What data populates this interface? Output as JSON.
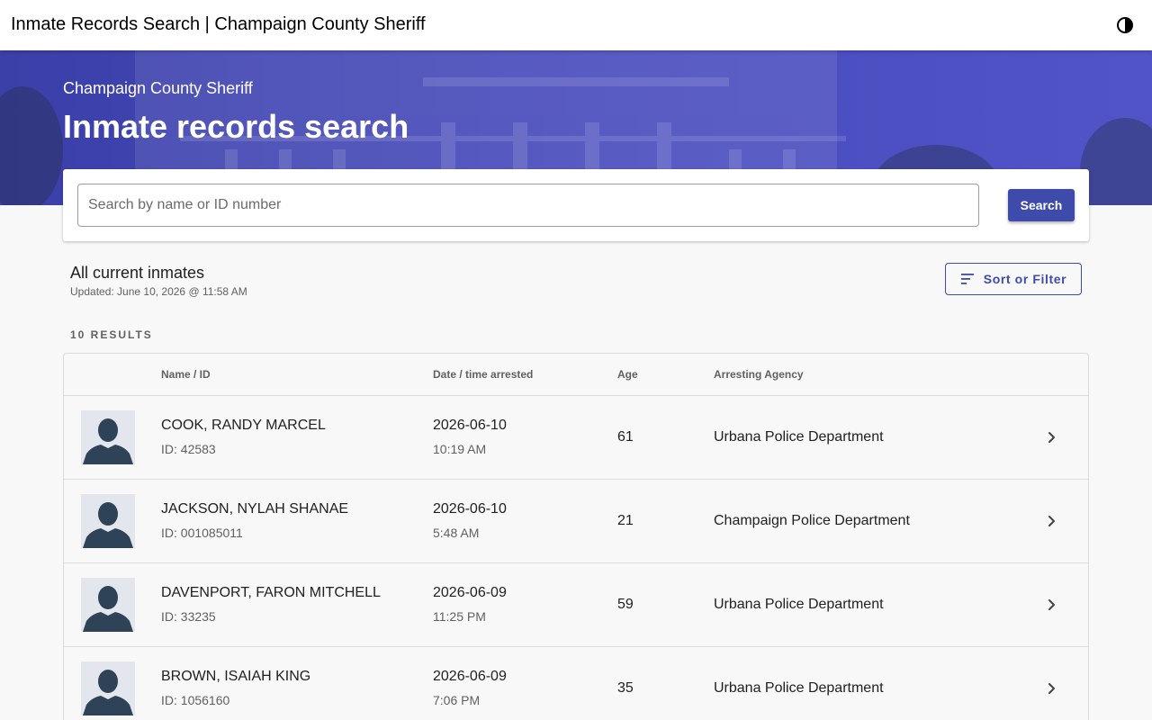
{
  "topbar": {
    "title": "Inmate Records Search | Champaign County Sheriff",
    "theme_icon": "half-moon-icon"
  },
  "hero": {
    "subtitle": "Champaign County Sheriff",
    "heading": "Inmate records search"
  },
  "search": {
    "placeholder": "Search by name or ID number",
    "value": "",
    "button_label": "Search"
  },
  "list": {
    "title": "All current inmates",
    "updated": "Updated: June 10, 2026 @ 11:58 AM",
    "sort_label": "Sort or Filter",
    "results_count": "10 RESULTS"
  },
  "table": {
    "columns": [
      "Name / ID",
      "Date / time arrested",
      "Age",
      "Arresting Agency"
    ],
    "rows": [
      {
        "name": "COOK, RANDY MARCEL",
        "id": "ID: 42583",
        "date": "2026-06-10",
        "time": "10:19 AM",
        "age": "61",
        "agency": "Urbana Police Department"
      },
      {
        "name": "JACKSON, NYLAH SHANAE",
        "id": "ID: 001085011",
        "date": "2026-06-10",
        "time": "5:48 AM",
        "age": "21",
        "agency": "Champaign Police Department"
      },
      {
        "name": "DAVENPORT, FARON MITCHELL",
        "id": "ID: 33235",
        "date": "2026-06-09",
        "time": "11:25 PM",
        "age": "59",
        "agency": "Urbana Police Department"
      },
      {
        "name": "BROWN, ISAIAH KING",
        "id": "ID: 1056160",
        "date": "2026-06-09",
        "time": "7:06 PM",
        "age": "35",
        "agency": "Urbana Police Department"
      }
    ]
  },
  "colors": {
    "accent": "#3f4bab",
    "hero": "#4549b9",
    "avatar_bg": "#e3e6ed",
    "avatar_fg": "#2f4358"
  }
}
